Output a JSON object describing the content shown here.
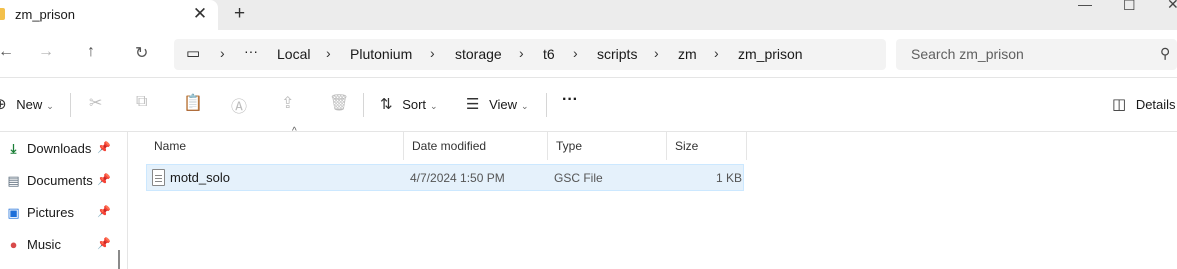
{
  "window": {
    "tab_title": "zm_prison",
    "new_tab_icon": "+",
    "close_tab_icon": "✕"
  },
  "addressbar": {
    "breadcrumbs": [
      "Local",
      "Plutonium",
      "storage",
      "t6",
      "scripts",
      "zm",
      "zm_prison"
    ],
    "ellipsis": "···",
    "search_placeholder": "Search zm_prison"
  },
  "toolbar": {
    "new_label": "New",
    "sort_label": "Sort",
    "view_label": "View",
    "more_label": "···",
    "details_label": "Details"
  },
  "sidebar": {
    "items": [
      {
        "label": "Downloads",
        "icon": "download-icon",
        "color": "#1a7f37"
      },
      {
        "label": "Documents",
        "icon": "document-icon",
        "color": "#5a6b7b"
      },
      {
        "label": "Pictures",
        "icon": "pictures-icon",
        "color": "#1e6fd9"
      },
      {
        "label": "Music",
        "icon": "music-icon",
        "color": "#d84a4a"
      }
    ]
  },
  "filelist": {
    "columns": [
      "Name",
      "Date modified",
      "Type",
      "Size"
    ],
    "rows": [
      {
        "name": "motd_solo",
        "date": "4/7/2024 1:50 PM",
        "type": "GSC File",
        "size": "1 KB"
      }
    ]
  },
  "colors": {
    "selection_bg": "#e5f1fb",
    "selection_border": "#cce8ff"
  }
}
